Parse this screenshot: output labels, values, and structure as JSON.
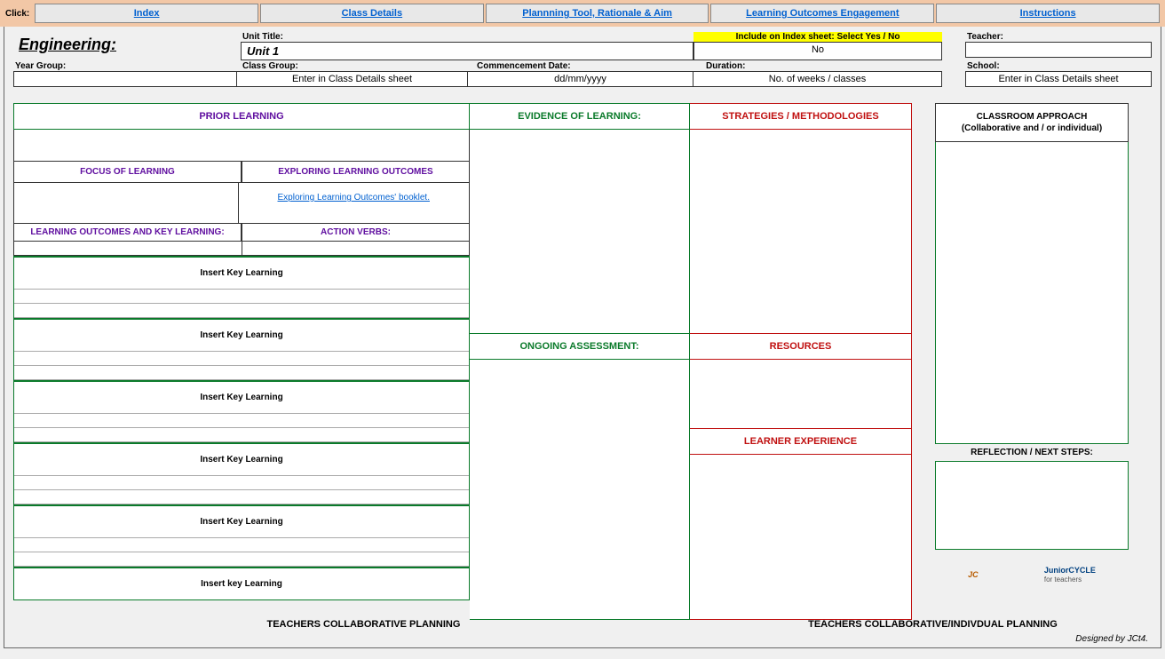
{
  "nav": {
    "click": "Click:",
    "index": "Index",
    "classDetails": "Class Details",
    "planning": "Plannning Tool, Rationale & Aim",
    "loe": "Learning Outcomes Engagement",
    "instructions": "Instructions"
  },
  "header": {
    "subject": "Engineering:",
    "unitTitleLbl": "Unit Title:",
    "unitTitle": "Unit 1",
    "includeLbl": "Include on Index sheet: Select Yes / No",
    "includeVal": "No",
    "teacherLbl": "Teacher:",
    "teacherVal": "",
    "yearGroupLbl": "Year Group:",
    "classGroupLbl": "Class Group:",
    "commencementLbl": "Commencement Date:",
    "durationLbl": "Duration:",
    "schoolLbl": "School:",
    "classGroupVal": "Enter in Class Details sheet",
    "commencementVal": "dd/mm/yyyy",
    "durationVal": "No. of weeks / classes",
    "schoolVal": "Enter in Class Details sheet"
  },
  "left": {
    "prior": "PRIOR LEARNING",
    "focus": "FOCUS OF LEARNING",
    "exploring": "EXPLORING LEARNING OUTCOMES",
    "bookletLink": "Exploring Learning Outcomes' booklet.",
    "lokl": "LEARNING OUTCOMES AND KEY LEARNING:",
    "actionVerbs": "ACTION VERBS:",
    "key1": "Insert Key Learning",
    "key2": "Insert Key Learning",
    "key3": "Insert Key Learning",
    "key4": "Insert Key Learning",
    "key5": "Insert Key Learning",
    "key6": "Insert key Learning"
  },
  "mid": {
    "evidence": "EVIDENCE OF LEARNING:",
    "ongoing": "ONGOING ASSESSMENT:"
  },
  "right": {
    "strategies": "STRATEGIES / METHODOLOGIES",
    "resources": "RESOURCES",
    "learner": "LEARNER EXPERIENCE"
  },
  "far": {
    "classroom1": "CLASSROOM APPROACH",
    "classroom2": "(Collaborative and / or individual)",
    "reflection": "REFLECTION / NEXT STEPS:"
  },
  "footer": {
    "collab": "TEACHERS COLLABORATIVE PLANNING",
    "indiv": "TEACHERS COLLABORATIVE/INDIVDUAL PLANNING",
    "designed": "Designed by JCt4."
  },
  "logos": {
    "jc": "JC",
    "jcyc": "JuniorCYCLE",
    "sub": "for teachers"
  }
}
